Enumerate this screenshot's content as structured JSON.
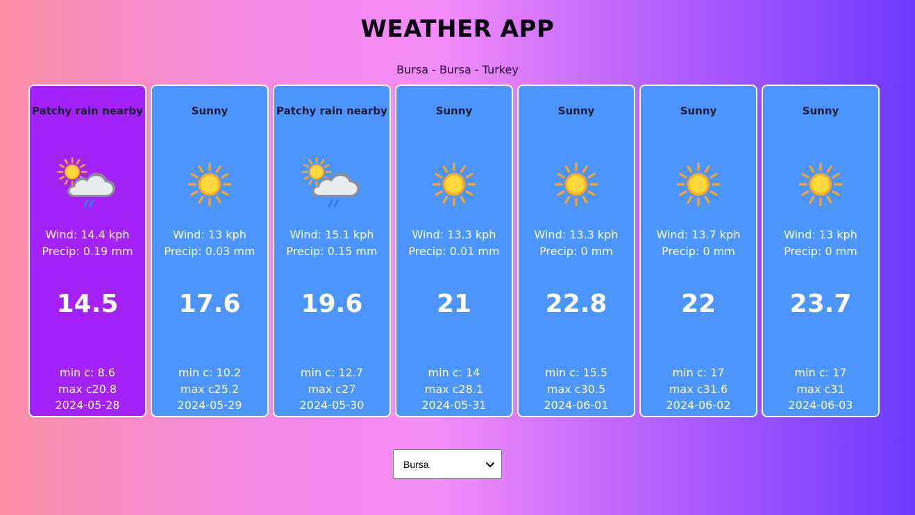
{
  "app": {
    "title": "WEATHER APP",
    "location": "Bursa - Bursa - Turkey"
  },
  "days": [
    {
      "condition": "Patchy rain nearby",
      "icon": "patchy-rain-icon",
      "wind": "Wind: 14.4 kph",
      "precip": "Precip: 0.19 mm",
      "temp": "14.5",
      "min": "min c: 8.6",
      "max": "max c20.8",
      "date": "2024-05-28",
      "selected": true
    },
    {
      "condition": "Sunny",
      "icon": "sun-icon",
      "wind": "Wind: 13 kph",
      "precip": "Precip: 0.03 mm",
      "temp": "17.6",
      "min": "min c: 10.2",
      "max": "max c25.2",
      "date": "2024-05-29",
      "selected": false
    },
    {
      "condition": "Patchy rain nearby",
      "icon": "patchy-rain-icon",
      "wind": "Wind: 15.1 kph",
      "precip": "Precip: 0.15 mm",
      "temp": "19.6",
      "min": "min c: 12.7",
      "max": "max c27",
      "date": "2024-05-30",
      "selected": false
    },
    {
      "condition": "Sunny",
      "icon": "sun-icon",
      "wind": "Wind: 13.3 kph",
      "precip": "Precip: 0.01 mm",
      "temp": "21",
      "min": "min c: 14",
      "max": "max c28.1",
      "date": "2024-05-31",
      "selected": false
    },
    {
      "condition": "Sunny",
      "icon": "sun-icon",
      "wind": "Wind: 13.3 kph",
      "precip": "Precip: 0 mm",
      "temp": "22.8",
      "min": "min c: 15.5",
      "max": "max c30.5",
      "date": "2024-06-01",
      "selected": false
    },
    {
      "condition": "Sunny",
      "icon": "sun-icon",
      "wind": "Wind: 13.7 kph",
      "precip": "Precip: 0 mm",
      "temp": "22",
      "min": "min c: 17",
      "max": "max c31.6",
      "date": "2024-06-02",
      "selected": false
    },
    {
      "condition": "Sunny",
      "icon": "sun-icon",
      "wind": "Wind: 13 kph",
      "precip": "Precip: 0 mm",
      "temp": "23.7",
      "min": "min c: 17",
      "max": "max c31",
      "date": "2024-06-03",
      "selected": false
    }
  ],
  "city_select": {
    "value": "Bursa"
  },
  "colors": {
    "card": "#4d95fe",
    "card_selected": "#a422f8"
  }
}
